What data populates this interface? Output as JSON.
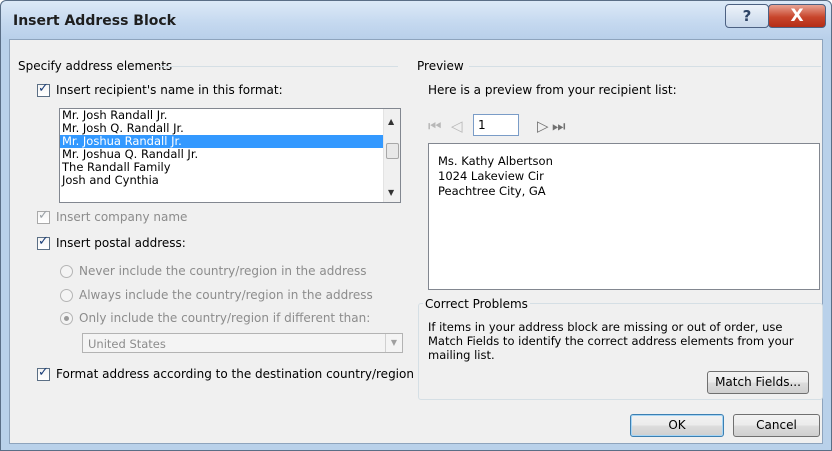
{
  "window": {
    "title": "Insert Address Block",
    "help_label": "?",
    "close_label": "X"
  },
  "left": {
    "group_label": "Specify address elements",
    "insert_name": {
      "label": "Insert recipient's name in this format:",
      "checked": true
    },
    "name_formats": [
      "Mr. Josh Randall Jr.",
      "Mr. Josh Q. Randall Jr.",
      "Mr. Joshua Randall Jr.",
      "Mr. Joshua Q. Randall Jr.",
      "The Randall Family",
      "Josh and Cynthia"
    ],
    "selected_format_index": 2,
    "insert_company": {
      "label": "Insert company name",
      "checked": true
    },
    "insert_postal": {
      "label": "Insert postal address:",
      "checked": true
    },
    "country_options": [
      "Never include the country/region in the address",
      "Always include the country/region in the address",
      "Only include the country/region if different than:"
    ],
    "selected_country_option_index": 2,
    "country_value": "United States",
    "format_by_destination": {
      "label": "Format address according to the destination country/region",
      "checked": true
    }
  },
  "preview": {
    "group_label": "Preview",
    "caption": "Here is a preview from your recipient list:",
    "record_number": "1",
    "lines": [
      "Ms. Kathy Albertson",
      "1024 Lakeview Cir",
      "Peachtree City, GA"
    ]
  },
  "correct": {
    "group_label": "Correct Problems",
    "text": "If items in your address block are missing or out of order, use Match Fields to identify the correct address elements from your mailing list.",
    "match_fields_label": "Match Fields..."
  },
  "buttons": {
    "ok": "OK",
    "cancel": "Cancel"
  },
  "icons": {
    "first": "first-record-icon",
    "prev": "previous-record-icon",
    "next": "next-record-icon",
    "last": "last-record-icon",
    "help": "help-icon",
    "close": "close-icon"
  }
}
